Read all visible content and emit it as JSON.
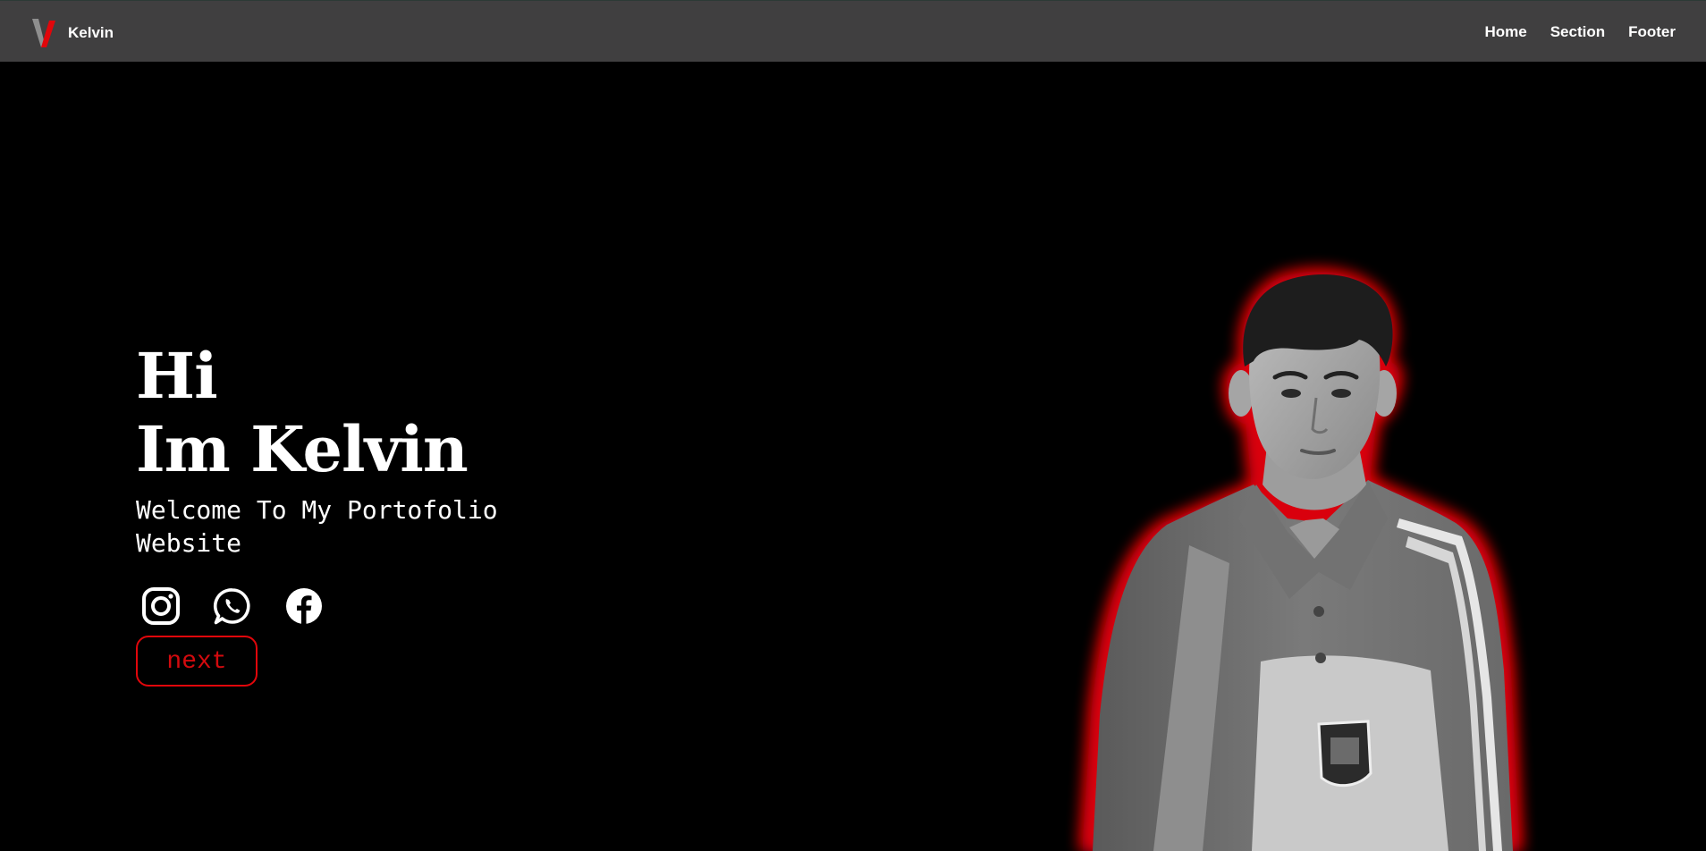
{
  "navbar": {
    "brand_name": "Kelvin",
    "links": [
      "Home",
      "Section",
      "Footer"
    ],
    "logo_icon": "v-logo-icon"
  },
  "hero": {
    "line1": "Hi",
    "line2": "Im Kelvin",
    "subtitle": "Welcome To My Portofolio Website",
    "socials": [
      "instagram-icon",
      "whatsapp-icon",
      "facebook-icon"
    ],
    "next_label": "next"
  },
  "colors": {
    "background": "#000000",
    "navbar": "#403f40",
    "accent_red": "#e1060b",
    "text": "#ffffff"
  }
}
